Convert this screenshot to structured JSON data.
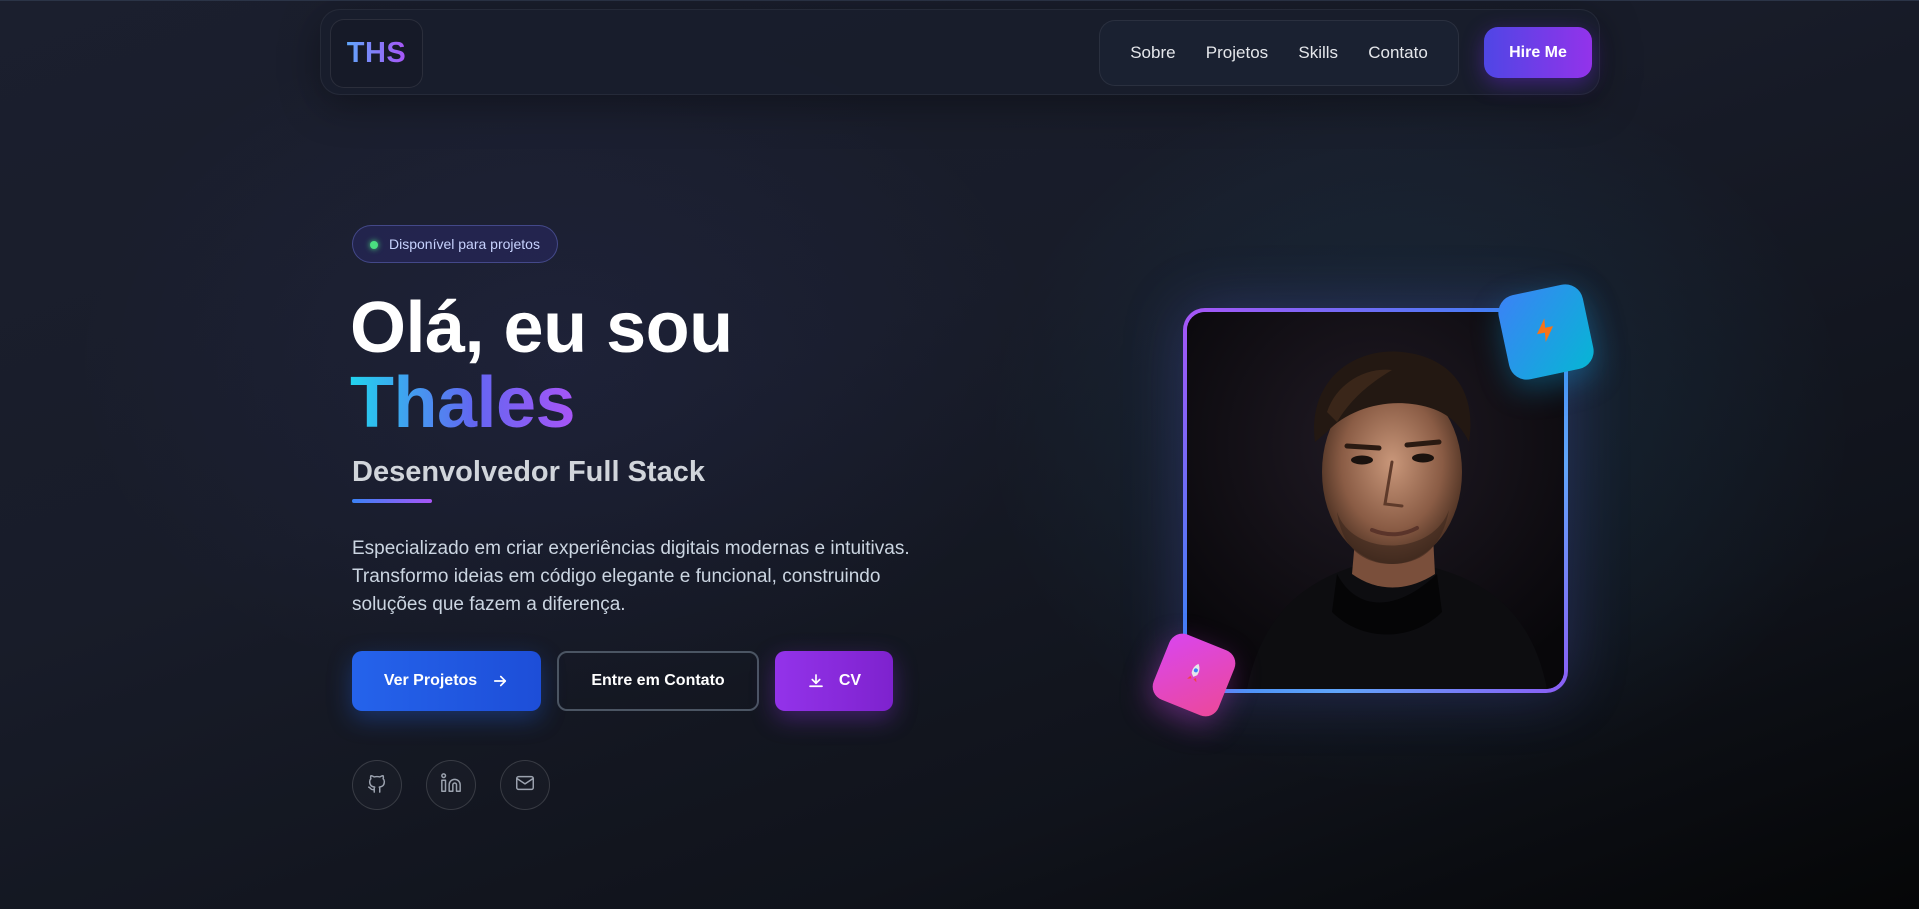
{
  "nav": {
    "logo": "THS",
    "links": [
      "Sobre",
      "Projetos",
      "Skills",
      "Contato"
    ],
    "cta": "Hire Me"
  },
  "hero": {
    "badge": "Disponível para projetos",
    "greeting": "Olá, eu sou",
    "name": "Thales",
    "role": "Desenvolvedor Full Stack",
    "description": "Especializado em criar experiências digitais modernas e intuitivas. Transformo ideias em código elegante e funcional, construindo soluções que fazem a diferença.",
    "buttons": {
      "projects": "Ver Projetos",
      "contact": "Entre em Contato",
      "cv": "CV"
    },
    "social_icons": [
      "github-icon",
      "linkedin-icon",
      "mail-icon"
    ],
    "float_icons": [
      "lightning-icon",
      "rocket-icon"
    ]
  },
  "colors": {
    "accent_blue": "#2563eb",
    "accent_purple": "#9333ea",
    "status_green": "#4ade80"
  }
}
